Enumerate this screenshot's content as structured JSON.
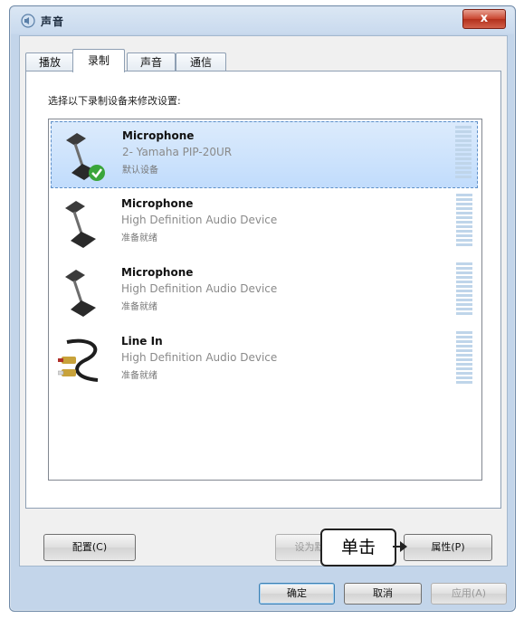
{
  "window": {
    "title": "声音",
    "close_label": "x"
  },
  "tabs": [
    {
      "label": "播放",
      "active": false
    },
    {
      "label": "录制",
      "active": true
    },
    {
      "label": "声音",
      "active": false
    },
    {
      "label": "通信",
      "active": false
    }
  ],
  "panel": {
    "instruction": "选择以下录制设备来修改设置:"
  },
  "devices": [
    {
      "name": "Microphone",
      "description": "2- Yamaha PIP-20UR",
      "status": "默认设备",
      "icon": "microphone-icon",
      "selected": true,
      "default": true
    },
    {
      "name": "Microphone",
      "description": "High Definition Audio Device",
      "status": "准备就绪",
      "icon": "microphone-icon",
      "selected": false,
      "default": false
    },
    {
      "name": "Microphone",
      "description": "High Definition Audio Device",
      "status": "准备就绪",
      "icon": "microphone-icon",
      "selected": false,
      "default": false
    },
    {
      "name": "Line In",
      "description": "High Definition Audio Device",
      "status": "准备就绪",
      "icon": "rca-cable-icon",
      "selected": false,
      "default": false
    }
  ],
  "buttons": {
    "configure": "配置(C)",
    "set_default": "设为默认值",
    "properties": "属性(P)",
    "ok": "确定",
    "cancel": "取消",
    "apply": "应用(A)"
  },
  "annotation": {
    "callout_text": "单击"
  },
  "colors": {
    "selection": "#c1dcfc",
    "check_green": "#3aa53a",
    "level_meter": "#bfd5ea"
  }
}
